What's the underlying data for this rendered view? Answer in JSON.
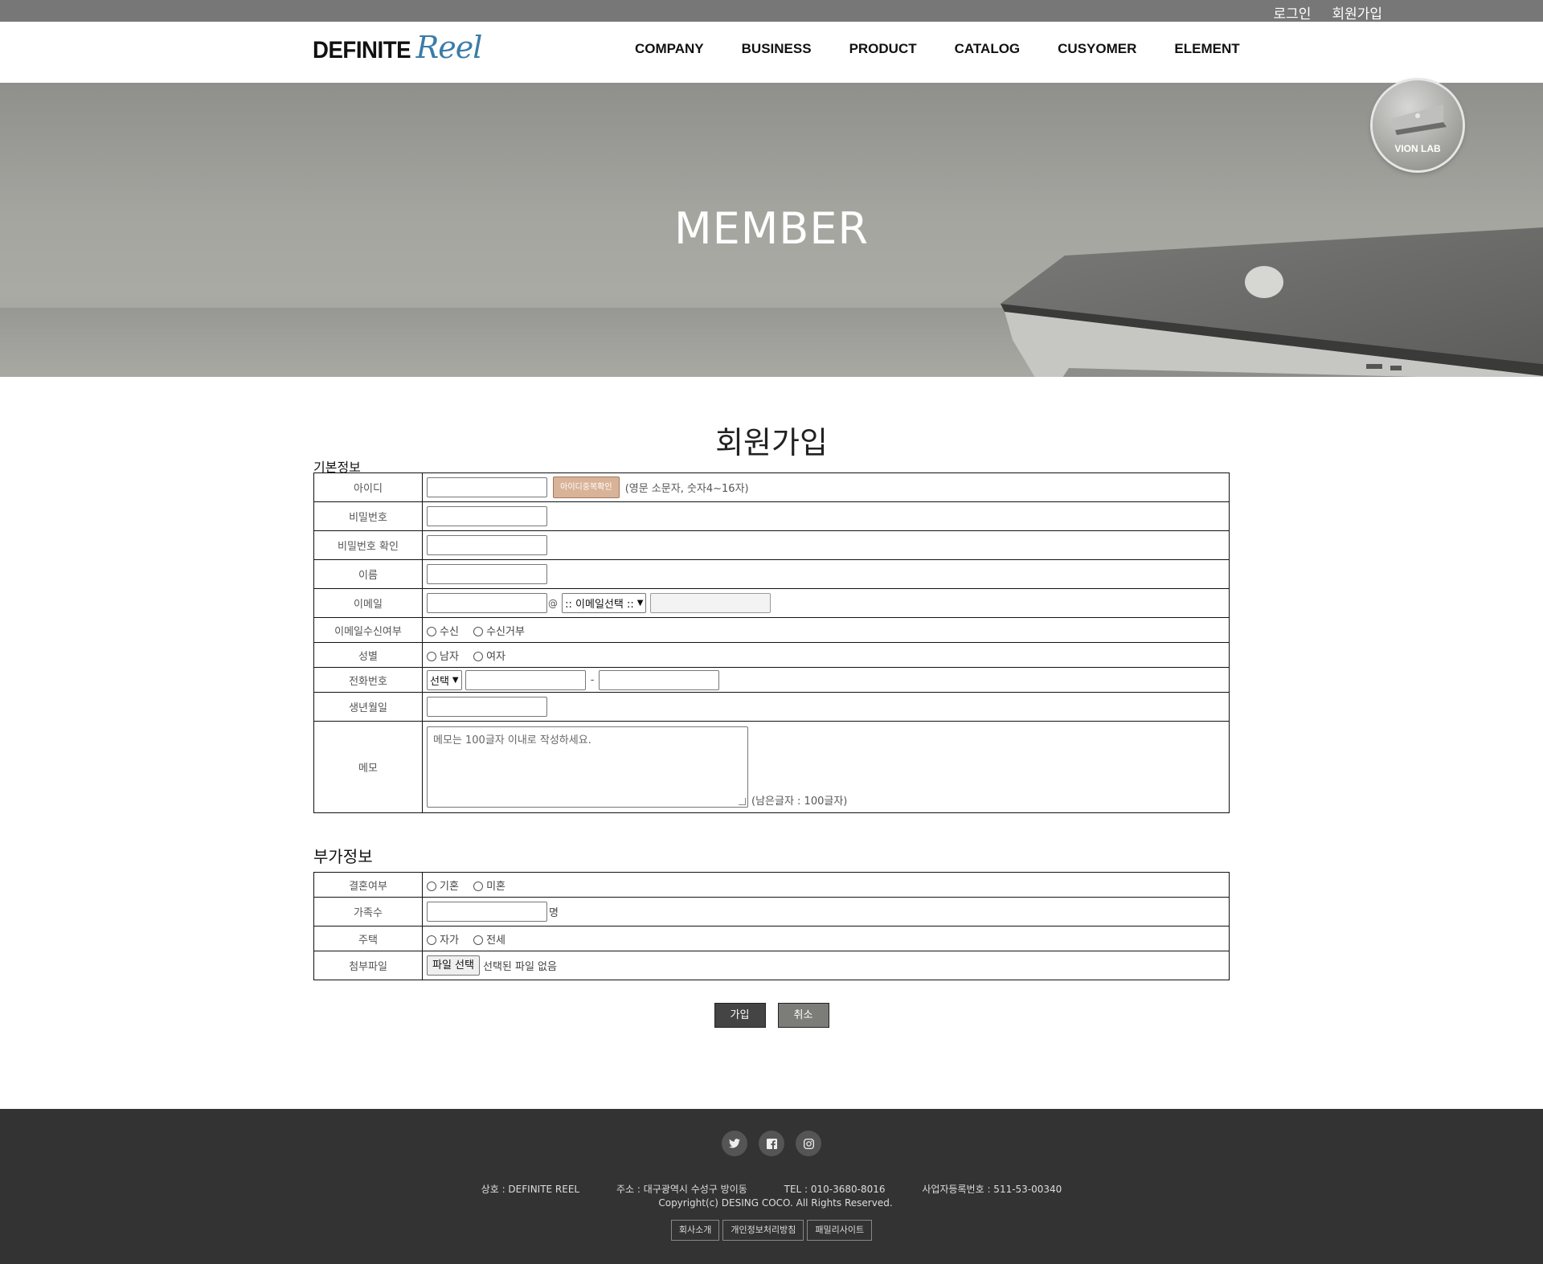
{
  "util_links": {
    "login": "로그인",
    "signup": "회원가입"
  },
  "logo": {
    "main": "DEFINITE",
    "script": "Reel"
  },
  "nav": [
    "COMPANY",
    "BUSINESS",
    "PRODUCT",
    "CATALOG",
    "CUSYOMER",
    "ELEMENT"
  ],
  "hero": {
    "title": "MEMBER",
    "badge": "VION LAB"
  },
  "form": {
    "title": "회원가입",
    "basic_section": "기본정보",
    "extra_section": "부가정보",
    "fields": {
      "id_label": "아이디",
      "id_check_button": "아이디중복확인",
      "id_hint": "(영문 소문자, 숫자4~16자)",
      "password_label": "비밀번호",
      "password_confirm_label": "비밀번호 확인",
      "name_label": "이름",
      "email_label": "이메일",
      "email_at": "@",
      "email_select": ":: 이메일선택 ::",
      "email_receive_label": "이메일수신여부",
      "email_receive_options": [
        "수신",
        "수신거부"
      ],
      "gender_label": "성별",
      "gender_options": [
        "남자",
        "여자"
      ],
      "phone_label": "전화번호",
      "phone_select": "선택",
      "phone_dash": "-",
      "birth_label": "생년월일",
      "memo_label": "메모",
      "memo_placeholder": "메모는 100글자 이내로 작성하세요.",
      "memo_count": "(남은글자 : 100글자)",
      "marital_label": "결혼여부",
      "marital_options": [
        "기혼",
        "미혼"
      ],
      "family_label": "가족수",
      "family_unit": "명",
      "housing_label": "주택",
      "housing_options": [
        "자가",
        "전세"
      ],
      "file_label": "첨부파일",
      "file_button": "파일 선택",
      "file_none": "선택된 파일 없음"
    },
    "buttons": {
      "join": "가입",
      "cancel": "취소"
    }
  },
  "footer": {
    "social_icons": [
      "twitter-icon",
      "facebook-icon",
      "instagram-icon"
    ],
    "company": "상호 : DEFINITE REEL",
    "address": "주소 : 대구광역시 수성구 방이동",
    "tel": "TEL : 010-3680-8016",
    "business_no": "사업자등록번호 : 511-53-00340",
    "copyright": "Copyright(c) DESING COCO. All Rights Reserved.",
    "links": [
      "회사소개",
      "개인정보처리방침",
      "패밀리사이트"
    ]
  },
  "colors": {
    "util_bar": "#777777",
    "footer_bg": "#333333",
    "dup_button": "#d9b398",
    "join_button": "#444444",
    "cancel_button": "#7c7d78",
    "logo_script": "#3b7ca8"
  }
}
